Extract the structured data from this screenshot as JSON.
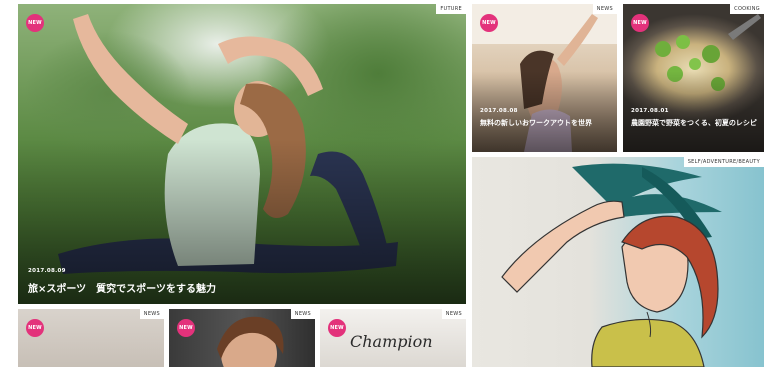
{
  "tiles": {
    "main": {
      "badge": "NEW",
      "category": "FUTURE",
      "date": "2017.08.09",
      "title": "旅×スポーツ　質究でスポーツをする魅力"
    },
    "top_mid": {
      "badge": "NEW",
      "category": "NEWS",
      "date": "2017.08.08",
      "title": "無料の新しいおワークアウトを世界"
    },
    "top_right": {
      "badge": "NEW",
      "category": "COOKING",
      "date": "2017.08.01",
      "title": "農園野菜で野菜をつくる、初夏のレシピ"
    },
    "mid_right": {
      "category": "SELF/ADVENTURE/BEAUTY"
    },
    "bottom_1": {
      "badge": "NEW",
      "category": "NEWS"
    },
    "bottom_2": {
      "badge": "NEW",
      "category": "NEWS"
    },
    "bottom_3": {
      "badge": "NEW",
      "category": "NEWS",
      "logo_text": "Champion"
    }
  },
  "colors": {
    "badge": "#e3327b",
    "background": "#ffffff"
  }
}
